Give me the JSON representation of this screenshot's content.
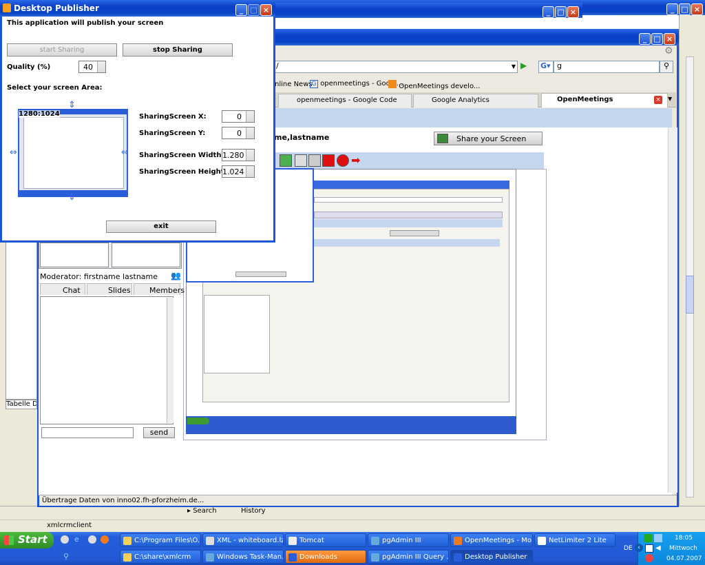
{
  "desktop_publisher": {
    "title": "Desktop Publisher",
    "intro": "This application will publish your screen",
    "start_button": "start Sharing",
    "stop_button": "stop Sharing",
    "quality_label": "Quality (%)",
    "quality_value": "40",
    "select_area_label": "Select your screen Area:",
    "preview_label": "1280:1024",
    "x_label": "SharingScreen X:",
    "x_value": "0",
    "y_label": "SharingScreen Y:",
    "y_value": "0",
    "width_label": "SharingScreen Width:",
    "width_value": "1.280",
    "height_label": "SharingScreen Height:",
    "height_value": "1.024",
    "exit_button": "exit"
  },
  "browser": {
    "search_value": "g",
    "url_value": "/",
    "bookmarks": [
      "nline News",
      "openmeetings - Googl...",
      "OpenMeetings develo..."
    ],
    "tabs": [
      "openmeetings - Google Code",
      "Google Analytics",
      "OpenMeetings"
    ],
    "status": "Übertrage Daten von inno02.fh-pforzheim.de..."
  },
  "openmeetings": {
    "user_name": "me,lastname",
    "share_button": "Share your Screen",
    "moderator": "Moderator: firstname lastname",
    "tab_chat": "Chat",
    "tab_slides": "Slides",
    "tab_members": "Members",
    "send_button": "send"
  },
  "ide": {
    "left_label": "Tabelle Def",
    "search_tab": "Search",
    "history_tab": "History",
    "console_label": "xmlcrmclient"
  },
  "taskbar": {
    "start": "Start",
    "row1": [
      "C:\\Program Files\\O...",
      "XML - whiteboard.lz...",
      "Tomcat",
      "pgAdmin III",
      "OpenMeetings - Mo...",
      "NetLimiter 2 Lite"
    ],
    "row2": [
      "C:\\share\\xmlcrm",
      "Windows Task-Man...",
      "Downloads",
      "pgAdmin III Query ...",
      "Desktop Publisher"
    ],
    "lang": "DE",
    "time": "18:05",
    "day": "Mittwoch",
    "date": "04.07.2007"
  },
  "colors": {
    "xp_blue": "#0a3fc8",
    "taskbar": "#245edb",
    "start_green": "#3c9a2e",
    "tray": "#0f8ae8"
  }
}
